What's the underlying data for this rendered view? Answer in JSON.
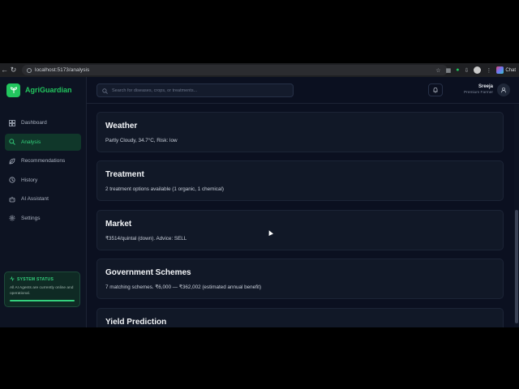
{
  "browser": {
    "url": "localhost:5173/analysis",
    "chat_label": "Chat"
  },
  "brand": {
    "name": "AgriGuardian"
  },
  "sidebar": {
    "items": [
      {
        "label": "Dashboard",
        "icon": "grid-icon",
        "active": false
      },
      {
        "label": "Analysis",
        "icon": "search-icon",
        "active": true
      },
      {
        "label": "Recommendations",
        "icon": "leaf-icon",
        "active": false
      },
      {
        "label": "History",
        "icon": "history-icon",
        "active": false
      },
      {
        "label": "AI Assistant",
        "icon": "robot-icon",
        "active": false
      },
      {
        "label": "Settings",
        "icon": "gear-icon",
        "active": false
      }
    ],
    "status": {
      "title": "SYSTEM STATUS",
      "text": "All AI Agents are currently online and operational.",
      "progress": 1.0
    }
  },
  "header": {
    "search_placeholder": "Search for diseases, crops, or treatments...",
    "user_name": "Sreeja",
    "user_role": "Premium Farmer"
  },
  "cards": [
    {
      "title": "Weather",
      "text": "Partly Cloudy, 34.7°C, Risk: low"
    },
    {
      "title": "Treatment",
      "text": "2 treatment options available (1 organic, 1 chemical)"
    },
    {
      "title": "Market",
      "text": "₹3514/quintal (down). Advice: SELL"
    },
    {
      "title": "Government Schemes",
      "text": "7 matching schemes. ₹6,000 — ₹362,002 (estimated annual benefit)"
    },
    {
      "title": "Yield Prediction",
      "text": ""
    }
  ],
  "colors": {
    "accent": "#22c55e",
    "background": "#0b1020",
    "card": "#111827"
  }
}
